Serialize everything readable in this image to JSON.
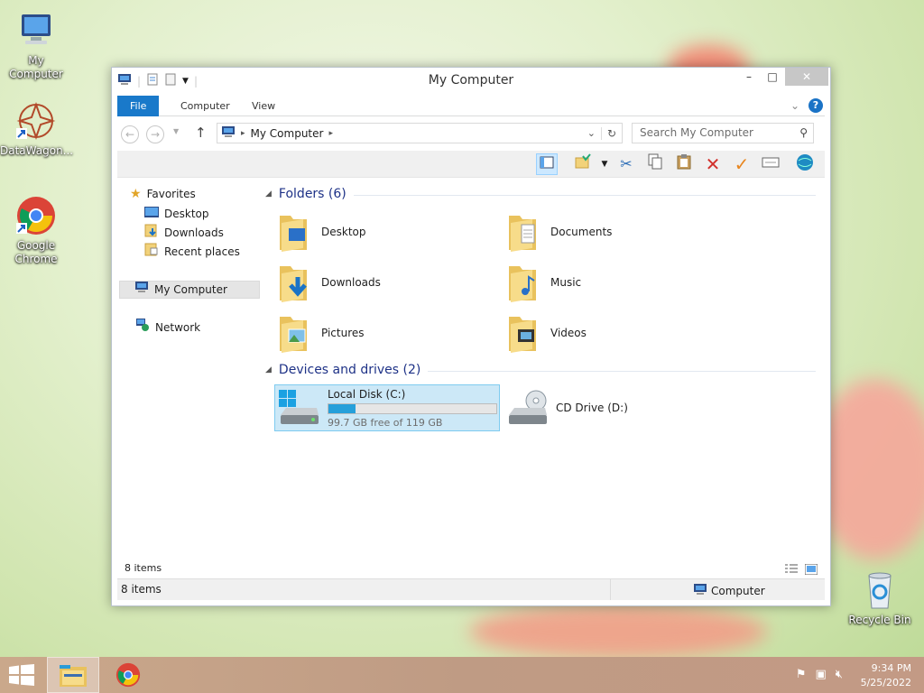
{
  "desktop": {
    "icons": [
      {
        "label": "My Computer",
        "icon": "computer-icon"
      },
      {
        "label": "DataWagon...",
        "icon": "datawagon-icon"
      },
      {
        "label": "Google Chrome",
        "icon": "chrome-icon"
      },
      {
        "label": "Recycle Bin",
        "icon": "recycle-bin-icon"
      }
    ]
  },
  "window": {
    "title": "My Computer",
    "controls": {
      "minimize": "–",
      "maximize": "□",
      "close": "✕"
    },
    "ribbon_tabs": [
      "File",
      "Computer",
      "View"
    ],
    "address": {
      "location": "My Computer"
    },
    "search": {
      "placeholder": "Search My Computer"
    },
    "nav": {
      "favorites": "Favorites",
      "favorites_items": [
        "Desktop",
        "Downloads",
        "Recent places"
      ],
      "computer": "My Computer",
      "network": "Network"
    },
    "folders_header": "Folders (6)",
    "folders": [
      {
        "name": "Desktop",
        "icon": "desktop-folder-icon"
      },
      {
        "name": "Documents",
        "icon": "documents-folder-icon"
      },
      {
        "name": "Downloads",
        "icon": "downloads-folder-icon"
      },
      {
        "name": "Music",
        "icon": "music-folder-icon"
      },
      {
        "name": "Pictures",
        "icon": "pictures-folder-icon"
      },
      {
        "name": "Videos",
        "icon": "videos-folder-icon"
      }
    ],
    "devices_header": "Devices and drives (2)",
    "drives": [
      {
        "name": "Local Disk (C:)",
        "free_text": "99.7 GB free of 119 GB",
        "used_fraction": 0.16,
        "icon": "hard-drive-icon"
      },
      {
        "name": "CD Drive (D:)",
        "icon": "cd-drive-icon"
      }
    ],
    "item_count": "8 items",
    "status": {
      "count": "8 items",
      "location": "Computer"
    }
  },
  "taskbar": {
    "clock_time": "9:34 PM",
    "clock_date": "5/25/2022",
    "colors": {
      "accent": "#1979ca",
      "selection": "#cce8f7",
      "bar_fill": "#26a0da"
    }
  }
}
